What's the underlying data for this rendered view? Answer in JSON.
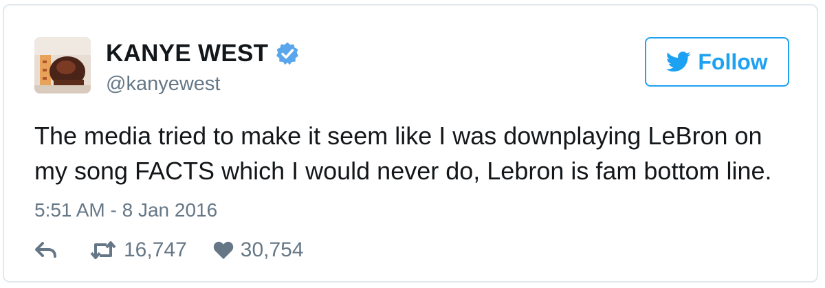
{
  "tweet": {
    "author": {
      "display_name": "KANYE WEST",
      "handle": "@kanyewest",
      "verified": true,
      "avatar_icon": "avatar-photo"
    },
    "follow_button": {
      "label": "Follow",
      "icon": "twitter-bird-icon"
    },
    "text_lines": [
      "The media tried to make it seem like I was downplaying LeBron on",
      "my song FACTS which I would never do, Lebron is fam bottom line."
    ],
    "timestamp": "5:51 AM - 8 Jan 2016",
    "actions": {
      "reply_icon": "reply-icon",
      "retweet_icon": "retweet-icon",
      "retweet_count": "16,747",
      "like_icon": "heart-icon",
      "like_count": "30,754"
    }
  },
  "colors": {
    "brand_blue": "#1da1f2",
    "verified_blue": "#5aa6ec",
    "text_primary": "#14171a",
    "text_secondary": "#657786",
    "border": "#e1e8ed"
  }
}
